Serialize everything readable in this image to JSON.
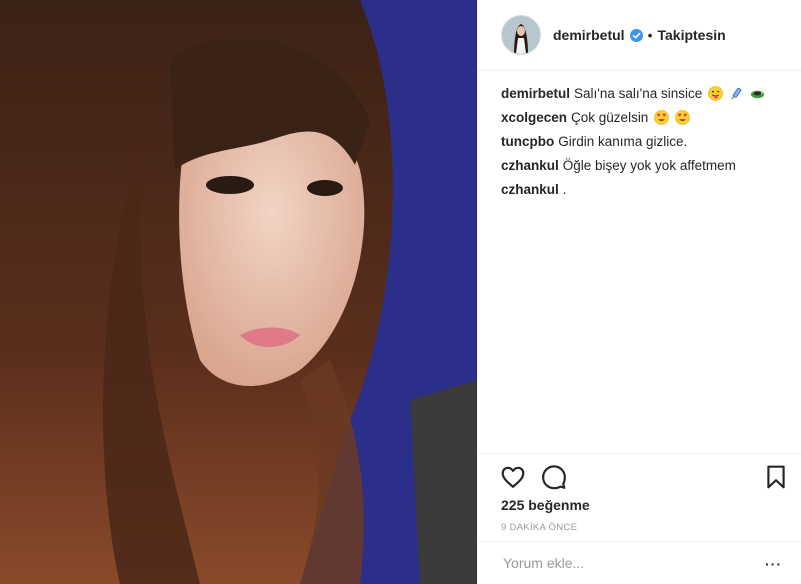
{
  "post": {
    "author": "demirbetul",
    "separator": "•",
    "follow_label": "Takiptesin",
    "likes": "225 beğenme",
    "time_ago": "9 DAKİKA ÖNCE",
    "comment_placeholder": "Yorum ekle...",
    "more": "···"
  },
  "comments": [
    {
      "user": "demirbetul",
      "text": "Salı'na salı'na sinsice",
      "emojis": [
        "tongue-face",
        "syringe",
        "snake"
      ]
    },
    {
      "user": "xcolgecen",
      "text": "Çok güzelsin",
      "emojis": [
        "heart-eyes",
        "heart-eyes"
      ]
    },
    {
      "user": "tuncpbo",
      "text": "Girdin kanıma gizlice.",
      "emojis": []
    },
    {
      "user": "czhankul",
      "text": "Öğle bişey yok yok affetmem",
      "emojis": []
    },
    {
      "user": "czhankul",
      "text": ".",
      "emojis": []
    }
  ],
  "icons": {
    "like": "heart-outline-icon",
    "comment": "comment-bubble-icon",
    "save": "bookmark-icon",
    "verified": "verified-badge-icon"
  },
  "colors": {
    "verified": "#3897f0",
    "border": "#efefef",
    "muted": "#999999"
  }
}
